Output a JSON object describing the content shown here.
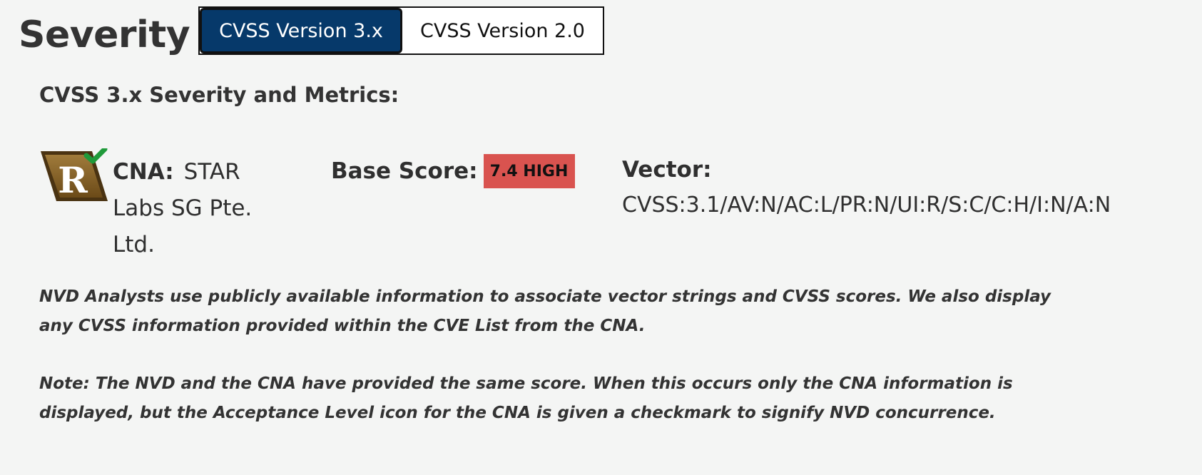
{
  "severity": {
    "title": "Severity"
  },
  "tabs": [
    {
      "label": "CVSS Version 3.x",
      "active": true
    },
    {
      "label": "CVSS Version 2.0",
      "active": false
    }
  ],
  "metrics": {
    "heading": "CVSS 3.x Severity and Metrics:",
    "acceptance_icon": {
      "name": "acceptance-level-r-checkmark-icon",
      "letter": "R"
    },
    "cna_label": "CNA:",
    "cna_value": "STAR Labs SG Pte. Ltd.",
    "base_score_label": "Base Score:",
    "base_score_badge": "7.4 HIGH",
    "vector_label": "Vector:",
    "vector_value": "CVSS:3.1/AV:N/AC:L/PR:N/UI:R/S:C/C:H/I:N/A:N"
  },
  "notes": [
    "NVD Analysts use publicly available information to associate vector strings and CVSS scores. We also display any CVSS information provided within the CVE List from the CNA.",
    "Note: The NVD and the CNA have provided the same score. When this occurs only the CNA information is displayed, but the Acceptance Level icon for the CNA is given a checkmark to signify NVD concurrence."
  ],
  "colors": {
    "tab_active": "#06396a",
    "badge_high": "#d9534f",
    "icon_brown": "#7a5a22",
    "checkmark": "#1f9a3a"
  }
}
